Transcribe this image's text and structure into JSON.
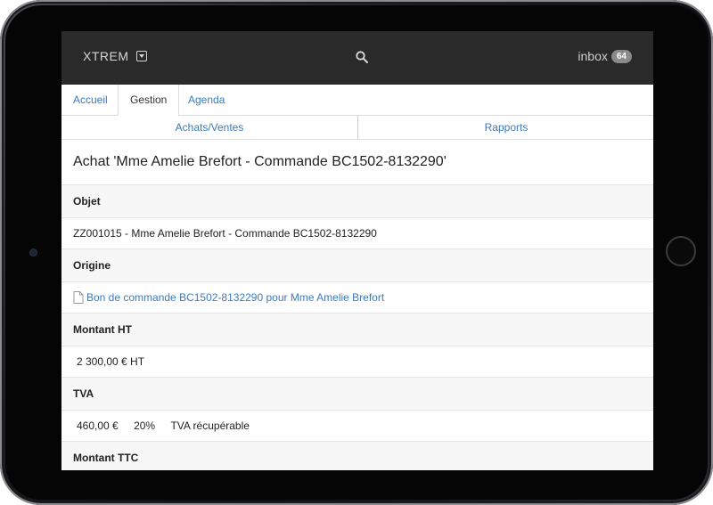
{
  "header": {
    "brand": "XTREM",
    "inbox_label": "inbox",
    "inbox_count": "64"
  },
  "tabs": [
    {
      "label": "Accueil"
    },
    {
      "label": "Gestion"
    },
    {
      "label": "Agenda"
    }
  ],
  "subnav": [
    {
      "label": "Achats/Ventes"
    },
    {
      "label": "Rapports"
    }
  ],
  "page": {
    "title": "Achat 'Mme Amelie Brefort - Commande BC1502-8132290'",
    "objet_label": "Objet",
    "objet_value": "ZZ001015 - Mme Amelie Brefort - Commande BC1502-8132290",
    "origine_label": "Origine",
    "origine_link": "Bon de commande BC1502-8132290 pour Mme Amelie Brefort",
    "montant_ht_label": "Montant HT",
    "montant_ht_value": "2 300,00 € HT",
    "tva_label": "TVA",
    "tva_amount": "460,00 €",
    "tva_rate": "20%",
    "tva_note": "TVA récupérable",
    "montant_ttc_label": "Montant TTC"
  },
  "colors": {
    "topbar": "#2a2a2a",
    "link": "#3a7bbf",
    "badge": "#8a8a8a"
  }
}
